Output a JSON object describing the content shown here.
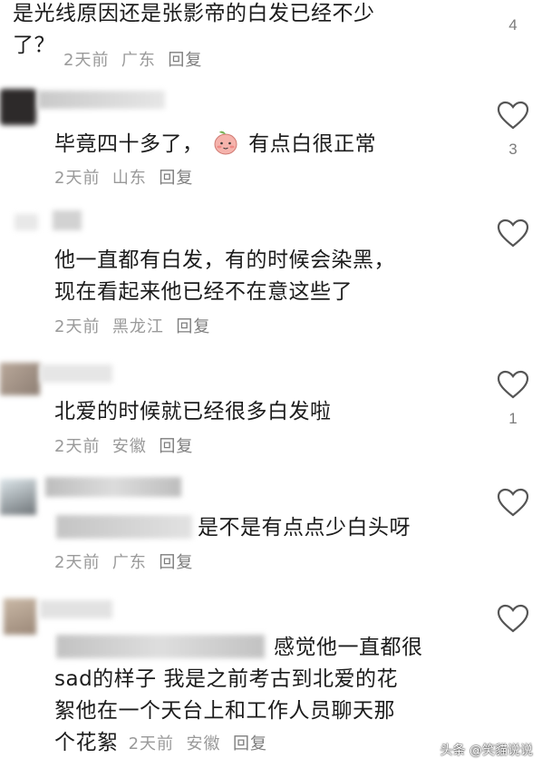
{
  "comments": [
    {
      "text_lines": [
        "是光线原因还是张影帝的白发已经不少",
        "了？"
      ],
      "time": "2天前",
      "location": "广东",
      "reply": "回复",
      "likes": "4"
    },
    {
      "text_before": "毕竟四十多了，",
      "text_after": "有点白很正常",
      "time": "2天前",
      "location": "山东",
      "reply": "回复",
      "likes": "3"
    },
    {
      "text_lines": [
        "他一直都有白发，有的时候会染黑，",
        "现在看起来他已经不在意这些了"
      ],
      "time": "2天前",
      "location": "黑龙江",
      "reply": "回复",
      "likes": ""
    },
    {
      "text_lines": [
        "北爱的时候就已经很多白发啦"
      ],
      "time": "2天前",
      "location": "安徽",
      "reply": "回复",
      "likes": "1"
    },
    {
      "text_lines": [
        "是不是有点点少白头呀"
      ],
      "time": "2天前",
      "location": "广东",
      "reply": "回复",
      "likes": ""
    },
    {
      "text_lines": [
        "感觉他一直都很",
        "sad的样子 我是之前考古到北爱的花",
        "絮他在一个天台上和工作人员聊天那",
        "个花絮"
      ],
      "time": "2天前",
      "location": "安徽",
      "reply": "回复",
      "likes": ""
    }
  ],
  "icons": {
    "like": "heart-outline-icon",
    "emoji": "peach-face-emoji-icon"
  },
  "watermark": "头条 @笑貓说说"
}
